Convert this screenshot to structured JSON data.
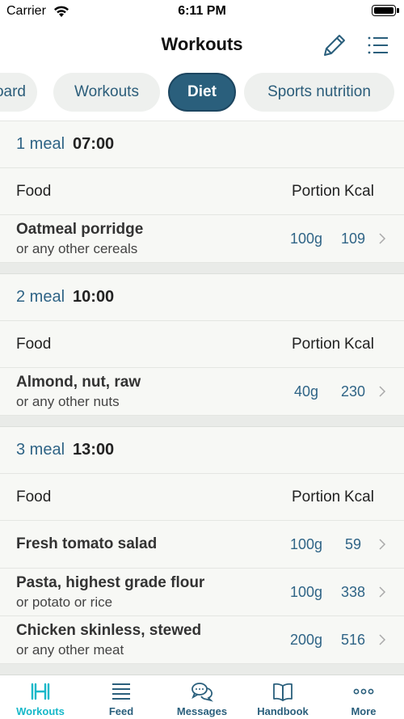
{
  "status_bar": {
    "carrier": "Carrier",
    "time": "6:11 PM"
  },
  "nav": {
    "title": "Workouts"
  },
  "tabs": [
    {
      "label": "Dashboard"
    },
    {
      "label": "Workouts"
    },
    {
      "label": "Diet",
      "active": true
    },
    {
      "label": "Sports nutrition"
    }
  ],
  "columns": {
    "food": "Food",
    "portion": "Portion",
    "kcal": "Kcal"
  },
  "meals": [
    {
      "label": "1 meal",
      "time": "07:00",
      "items": [
        {
          "name": "Oatmeal porridge",
          "alt": "or any other cereals",
          "portion": "100g",
          "kcal": "109"
        }
      ]
    },
    {
      "label": "2 meal",
      "time": "10:00",
      "items": [
        {
          "name": "Almond, nut, raw",
          "alt": "or any other nuts",
          "portion": "40g",
          "kcal": "230"
        }
      ]
    },
    {
      "label": "3 meal",
      "time": "13:00",
      "items": [
        {
          "name": "Fresh tomato salad",
          "alt": "",
          "portion": "100g",
          "kcal": "59"
        },
        {
          "name": "Pasta, highest grade flour",
          "alt": "or potato or rice",
          "portion": "100g",
          "kcal": "338"
        },
        {
          "name": "Chicken skinless, stewed",
          "alt": "or any other meat",
          "portion": "200g",
          "kcal": "516"
        }
      ]
    }
  ],
  "tab_bar": [
    {
      "label": "Workouts",
      "icon": "dumbbell-icon",
      "active": true
    },
    {
      "label": "Feed",
      "icon": "feed-lines-icon"
    },
    {
      "label": "Messages",
      "icon": "chat-bubbles-icon"
    },
    {
      "label": "Handbook",
      "icon": "book-icon"
    },
    {
      "label": "More",
      "icon": "more-dots-icon"
    }
  ],
  "colors": {
    "accent": "#2a5f7c",
    "active_tab_icon": "#17b8c9",
    "link_text": "#2f6486"
  }
}
